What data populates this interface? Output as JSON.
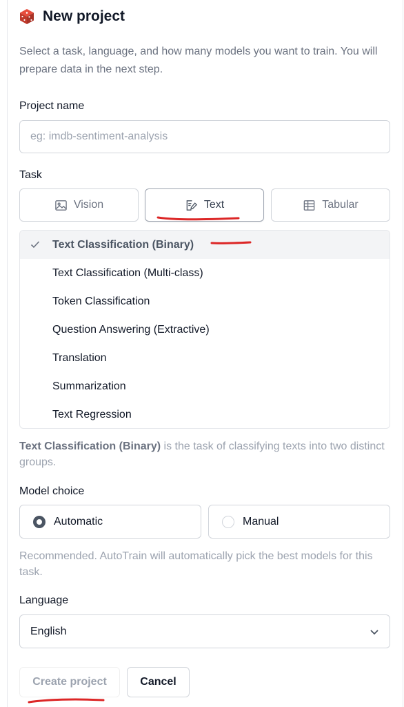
{
  "header": {
    "title": "New project",
    "description": "Select a task, language, and how many models you want to train. You will prepare data in the next step."
  },
  "project_name": {
    "label": "Project name",
    "placeholder": "eg: imdb-sentiment-analysis",
    "value": ""
  },
  "task": {
    "label": "Task",
    "tabs": [
      {
        "label": "Vision",
        "icon": "image-icon",
        "active": false
      },
      {
        "label": "Text",
        "icon": "edit-text-icon",
        "active": true
      },
      {
        "label": "Tabular",
        "icon": "table-icon",
        "active": false
      }
    ],
    "options": [
      "Text Classification (Binary)",
      "Text Classification (Multi-class)",
      "Token Classification",
      "Question Answering (Extractive)",
      "Translation",
      "Summarization",
      "Text Regression"
    ],
    "selected": "Text Classification (Binary)",
    "help_bold": "Text Classification (Binary)",
    "help_rest": " is the task of classifying texts into two distinct groups."
  },
  "model_choice": {
    "label": "Model choice",
    "options": [
      "Automatic",
      "Manual"
    ],
    "selected": "Automatic",
    "help": "Recommended. AutoTrain will automatically pick the best models for this task."
  },
  "language": {
    "label": "Language",
    "value": "English"
  },
  "actions": {
    "create": "Create project",
    "cancel": "Cancel"
  },
  "colors": {
    "accent_dark": "#4b5563",
    "annotation_red": "#dc2626",
    "logo_red": "#c0392b"
  }
}
